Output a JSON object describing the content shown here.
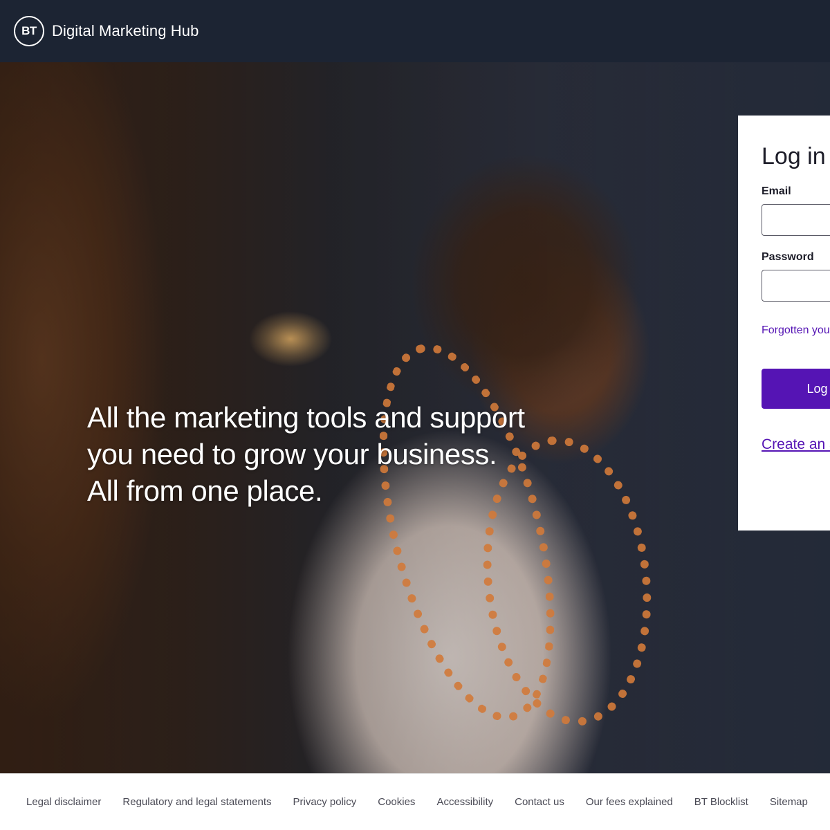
{
  "header": {
    "logo_text": "BT",
    "title": "Digital Marketing Hub"
  },
  "hero": {
    "headline": "All the marketing tools and support you need to grow your business. All from one place."
  },
  "login": {
    "title": "Log in to Digital Marketing Hub",
    "email_label": "Email",
    "email_value": "",
    "password_label": "Password",
    "password_value": "",
    "forgot_link": "Forgotten your password?",
    "submit_label": "Log in",
    "create_link": "Create an account"
  },
  "footer": {
    "links": [
      "Legal disclaimer",
      "Regulatory and legal statements",
      "Privacy policy",
      "Cookies",
      "Accessibility",
      "Contact us",
      "Our fees explained",
      "BT Blocklist",
      "Sitemap"
    ]
  },
  "colors": {
    "header_bg": "#1c2433",
    "accent": "#5514b4",
    "text_dark": "#1c1c28",
    "footer_text": "#4a4a55"
  },
  "icons": {
    "logo": "bt-logo-icon"
  }
}
